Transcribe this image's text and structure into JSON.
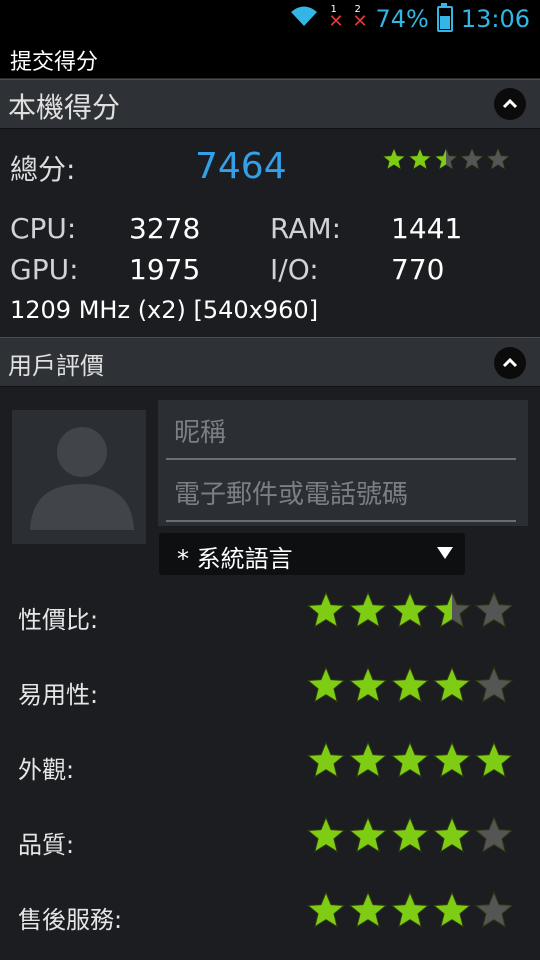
{
  "status_bar": {
    "battery": "74%",
    "time": "13:06",
    "sim1": "1",
    "sim2": "2"
  },
  "app_bar": {
    "title": "提交得分"
  },
  "my_score": {
    "header": "本機得分",
    "total_label": "總分:",
    "total_value": "7464",
    "total_rating": 2.5,
    "cpu_label": "CPU:",
    "cpu_value": "3278",
    "ram_label": "RAM:",
    "ram_value": "1441",
    "gpu_label": "GPU:",
    "gpu_value": "1975",
    "io_label": "I/O:",
    "io_value": "770",
    "device_info": "1209 MHz (x2) [540x960]"
  },
  "user_review": {
    "header": "用戶評價",
    "nickname_placeholder": "昵稱",
    "contact_placeholder": "電子郵件或電話號碼",
    "language": "* 系統語言",
    "ratings": [
      {
        "label": "性價比:",
        "value": 3.5
      },
      {
        "label": "易用性:",
        "value": 4
      },
      {
        "label": "外觀:",
        "value": 5
      },
      {
        "label": "品質:",
        "value": 4
      },
      {
        "label": "售後服務:",
        "value": 4
      }
    ]
  },
  "colors": {
    "star_on": "#7fcc14",
    "star_off": "#555555",
    "score": "#33a0e8",
    "status": "#33b5e5"
  }
}
